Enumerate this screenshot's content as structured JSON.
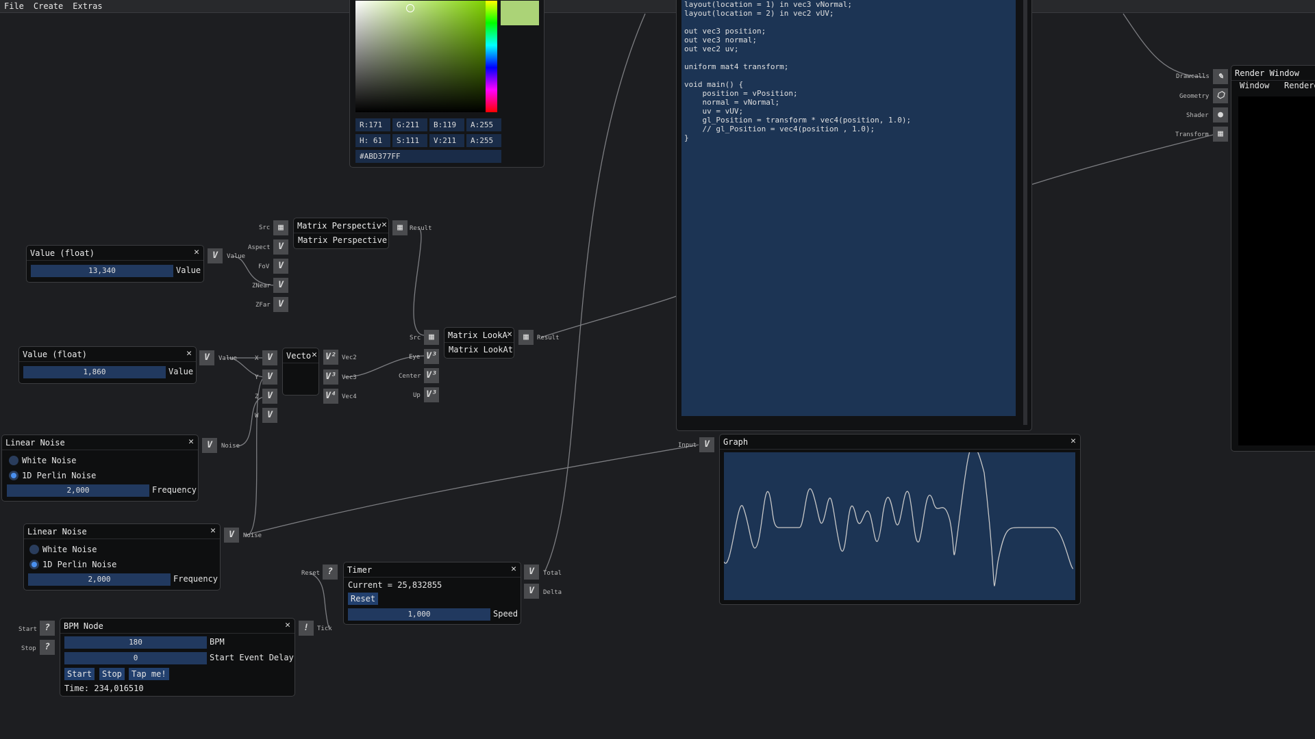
{
  "menu": {
    "file": "File",
    "create": "Create",
    "extras": "Extras"
  },
  "color_picker": {
    "swatch": "#ABD377",
    "r": "R:171",
    "g": "G:211",
    "b": "B:119",
    "a": "A:255",
    "h": "H: 61",
    "s": "S:111",
    "v": "V:211",
    "a2": "A:255",
    "hex": "#ABD377FF"
  },
  "shader_code": {
    "lines": [
      "layout(location = 1) in vec3 vNormal;",
      "layout(location = 2) in vec2 vUV;",
      "",
      "out vec3 position;",
      "out vec3 normal;",
      "out vec2 uv;",
      "",
      "uniform mat4 transform;",
      "",
      "void main() {",
      "    position = vPosition;",
      "    normal = vNormal;",
      "    uv = vUV;",
      "    gl_Position = transform * vec4(position, 1.0);",
      "    // gl_Position = vec4(position , 1.0);",
      "}"
    ]
  },
  "render_window": {
    "title": "Render Window",
    "tabs": [
      "Window",
      "Renderer"
    ],
    "pins": [
      "Drawcalls",
      "Geometry",
      "Shader",
      "Transform"
    ]
  },
  "value_float_1": {
    "title": "Value (float)",
    "value": "13,340",
    "label": "Value",
    "pin": "Value"
  },
  "value_float_2": {
    "title": "Value (float)",
    "value": "1,860",
    "label": "Value",
    "pin": "Value"
  },
  "matrix_perspective": {
    "title": "Matrix Perspectiv",
    "body": "Matrix Perspective",
    "inputs": [
      "Src",
      "Aspect",
      "FoV",
      "ZNear",
      "ZFar"
    ],
    "output": "Result"
  },
  "matrix_lookat": {
    "title": "Matrix LookA",
    "body": "Matrix LookAt",
    "inputs": [
      "Src",
      "Eye",
      "Center",
      "Up"
    ],
    "output": "Result"
  },
  "vector": {
    "title": "Vecto",
    "inputs": [
      "X",
      "Y",
      "Z",
      "W"
    ],
    "outputs": [
      "Vec2",
      "Vec3",
      "Vec4"
    ]
  },
  "linear_noise_1": {
    "title": "Linear Noise",
    "opt1": "White Noise",
    "opt2": "1D Perlin Noise",
    "freq": "2,000",
    "freq_label": "Frequency",
    "pin": "Noise"
  },
  "linear_noise_2": {
    "title": "Linear Noise",
    "opt1": "White Noise",
    "opt2": "1D Perlin Noise",
    "freq": "2,000",
    "freq_label": "Frequency",
    "pin": "Noise"
  },
  "timer": {
    "title": "Timer",
    "current": "Current = 25,832855",
    "reset": "Reset",
    "speed": "1,000",
    "speed_label": "Speed",
    "in": "Reset",
    "out1": "Total",
    "out2": "Delta"
  },
  "bpm": {
    "title": "BPM Node",
    "bpm": "180",
    "bpm_label": "BPM",
    "delay": "0",
    "delay_label": "Start Event Delay",
    "start": "Start",
    "stop": "Stop",
    "tap": "Tap me!",
    "time": "Time: 234,016510",
    "in1": "Start",
    "in2": "Stop",
    "out": "Tick"
  },
  "graph": {
    "title": "Graph",
    "input": "Input"
  },
  "pin_glyphs": {
    "v": "V",
    "q": "?",
    "bang": "!",
    "v2": "V²",
    "v3": "V³",
    "v4": "V⁴"
  },
  "colors": {
    "accent": "#21395f",
    "bg": "#1d1e21"
  }
}
